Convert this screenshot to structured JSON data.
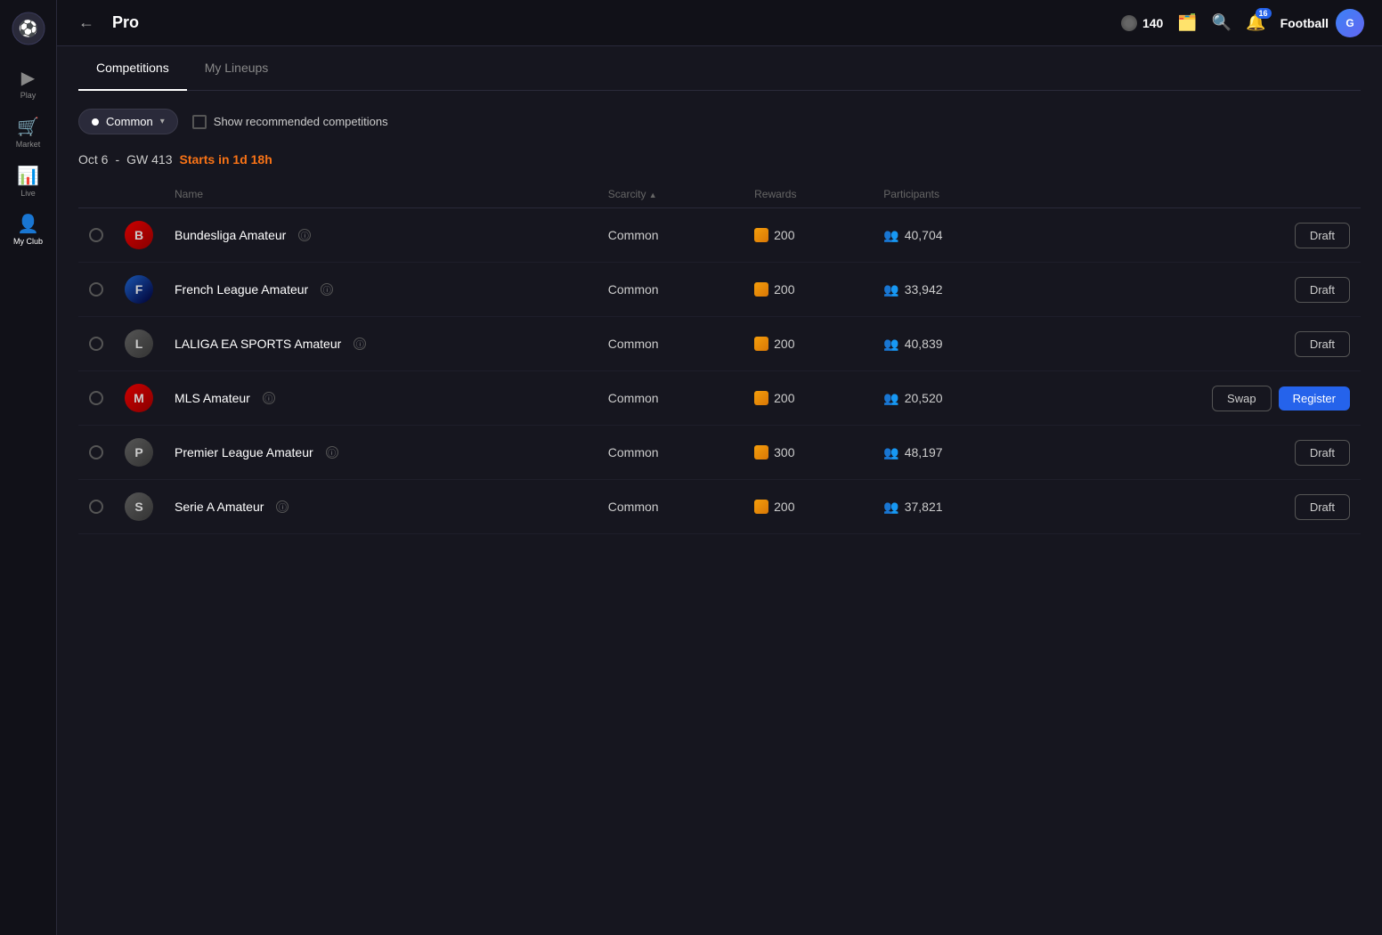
{
  "sidebar": {
    "logo": "⚽",
    "items": [
      {
        "id": "play",
        "label": "Play",
        "icon": "▶",
        "active": false
      },
      {
        "id": "market",
        "label": "Market",
        "icon": "🏪",
        "active": false
      },
      {
        "id": "live",
        "label": "Live",
        "icon": "📊",
        "active": false
      },
      {
        "id": "myclubs",
        "label": "My Club",
        "icon": "👤",
        "active": false
      }
    ]
  },
  "topbar": {
    "back_label": "←",
    "title": "Pro",
    "coins": "140",
    "coins_icon": "●",
    "search_icon": "🔍",
    "notification_count": "16",
    "football_label": "Football"
  },
  "tabs": [
    {
      "id": "competitions",
      "label": "Competitions",
      "active": true
    },
    {
      "id": "my-lineups",
      "label": "My Lineups",
      "active": false
    }
  ],
  "filter": {
    "common_label": "Common",
    "show_recommended_label": "Show recommended competitions"
  },
  "date_section": {
    "date": "Oct 6",
    "gw": "GW 413",
    "starts_label": "Starts in 1d 18h"
  },
  "table": {
    "columns": [
      {
        "id": "name",
        "label": "Name",
        "sortable": false
      },
      {
        "id": "scarcity",
        "label": "Scarcity",
        "sortable": true
      },
      {
        "id": "rewards",
        "label": "Rewards",
        "sortable": false
      },
      {
        "id": "participants",
        "label": "Participants",
        "sortable": false
      }
    ],
    "rows": [
      {
        "id": "bundesliga",
        "name": "Bundesliga Amateur",
        "logo_class": "logo-bundesliga",
        "logo_text": "B",
        "scarcity": "Common",
        "reward": "200",
        "participants": "40,704",
        "action": "Draft",
        "action2": null
      },
      {
        "id": "french",
        "name": "French League Amateur",
        "logo_class": "logo-french",
        "logo_text": "F",
        "scarcity": "Common",
        "reward": "200",
        "participants": "33,942",
        "action": "Draft",
        "action2": null
      },
      {
        "id": "laliga",
        "name": "LALIGA EA SPORTS Amateur",
        "logo_class": "logo-laliga",
        "logo_text": "L",
        "scarcity": "Common",
        "reward": "200",
        "participants": "40,839",
        "action": "Draft",
        "action2": null
      },
      {
        "id": "mls",
        "name": "MLS Amateur",
        "logo_class": "logo-mls",
        "logo_text": "M",
        "scarcity": "Common",
        "reward": "200",
        "participants": "20,520",
        "action": "Register",
        "action2": "Swap"
      },
      {
        "id": "premier",
        "name": "Premier League Amateur",
        "logo_class": "logo-premier",
        "logo_text": "P",
        "scarcity": "Common",
        "reward": "300",
        "participants": "48,197",
        "action": "Draft",
        "action2": null
      },
      {
        "id": "seriea",
        "name": "Serie A Amateur",
        "logo_class": "logo-serie",
        "logo_text": "S",
        "scarcity": "Common",
        "reward": "200",
        "participants": "37,821",
        "action": "Draft",
        "action2": null
      }
    ]
  }
}
